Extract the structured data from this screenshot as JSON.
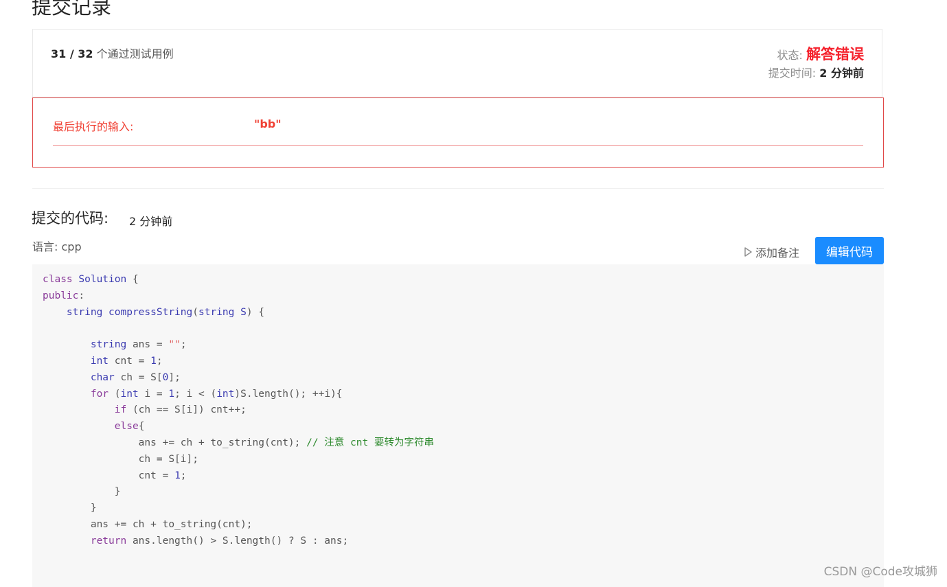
{
  "page": {
    "title": "提交记录"
  },
  "summary": {
    "passed_count": "31 / 32",
    "passed_text": "个通过测试用例",
    "status_label": "状态:",
    "status_value": "解答错误",
    "time_label": "提交时间:",
    "time_value": "2 分钟前"
  },
  "error": {
    "label": "最后执行的输入:",
    "value": "\"bb\""
  },
  "code": {
    "title": "提交的代码:",
    "time": "2 分钟前",
    "language_label": "语言:",
    "language": "cpp",
    "add_note_label": "添加备注",
    "edit_button_label": "编辑代码"
  },
  "colors": {
    "keyword": "#8a3c9a",
    "type": "#3a3ab0",
    "number": "#3a3ab0",
    "string": "#e06060",
    "comment": "#2e8a2e",
    "text": "#555555",
    "error": "#f5222d",
    "primary": "#1a8cff"
  },
  "code_lines": [
    [
      [
        "class",
        "kw"
      ],
      [
        " Solution ",
        "ty"
      ],
      [
        "{",
        "tx"
      ]
    ],
    [
      [
        "public",
        "kw"
      ],
      [
        ":",
        "tx"
      ]
    ],
    [
      [
        "    string compressString",
        "ty"
      ],
      [
        "(",
        "tx"
      ],
      [
        "string S",
        "ty"
      ],
      [
        ") {",
        "tx"
      ]
    ],
    [
      [
        "",
        "tx"
      ]
    ],
    [
      [
        "        string ",
        "ty"
      ],
      [
        "ans = ",
        "tx"
      ],
      [
        "\"\"",
        "str"
      ],
      [
        ";",
        "tx"
      ]
    ],
    [
      [
        "        int ",
        "ty"
      ],
      [
        "cnt = ",
        "tx"
      ],
      [
        "1",
        "num"
      ],
      [
        ";",
        "tx"
      ]
    ],
    [
      [
        "        char ",
        "ty"
      ],
      [
        "ch = S[",
        "tx"
      ],
      [
        "0",
        "num"
      ],
      [
        "];",
        "tx"
      ]
    ],
    [
      [
        "        for ",
        "kw"
      ],
      [
        "(",
        "tx"
      ],
      [
        "int ",
        "ty"
      ],
      [
        "i = ",
        "tx"
      ],
      [
        "1",
        "num"
      ],
      [
        "; i < (",
        "tx"
      ],
      [
        "int",
        "ty"
      ],
      [
        ")S.length(); ++i){",
        "tx"
      ]
    ],
    [
      [
        "            if ",
        "kw"
      ],
      [
        "(ch == S[i]) cnt++;",
        "tx"
      ]
    ],
    [
      [
        "            else",
        "kw"
      ],
      [
        "{",
        "tx"
      ]
    ],
    [
      [
        "                ans += ch + to_string(cnt); ",
        "tx"
      ],
      [
        "// 注意 cnt 要转为字符串",
        "cm"
      ]
    ],
    [
      [
        "                ch = S[i];",
        "tx"
      ]
    ],
    [
      [
        "                cnt = ",
        "tx"
      ],
      [
        "1",
        "num"
      ],
      [
        ";",
        "tx"
      ]
    ],
    [
      [
        "            }",
        "tx"
      ]
    ],
    [
      [
        "        }",
        "tx"
      ]
    ],
    [
      [
        "        ans += ch + to_string(cnt);",
        "tx"
      ]
    ],
    [
      [
        "        return ",
        "kw"
      ],
      [
        "ans.length() > S.length() ? S : ans;",
        "tx"
      ]
    ]
  ],
  "watermark": "CSDN @Code攻城狮"
}
